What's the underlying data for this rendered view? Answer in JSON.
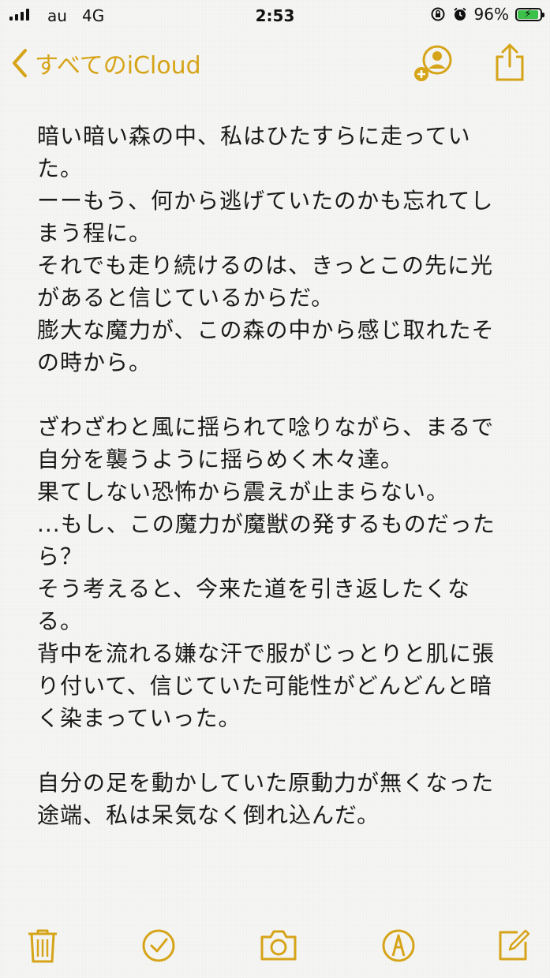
{
  "status_bar": {
    "carrier": "au",
    "network": "4G",
    "time": "2:53",
    "battery_text": "96%",
    "battery_level": 0.96
  },
  "nav": {
    "back_label": "すべてのiCloud",
    "back_icon": "chevron-left-icon",
    "add_person_icon": "add-person-icon",
    "share_icon": "share-icon"
  },
  "note": {
    "lines": [
      "暗い暗い森の中、私はひたすらに走ってい",
      "た。",
      "ーーもう、何から逃げていたのかも忘れてし",
      "まう程に。",
      "それでも走り続けるのは、きっとこの先に光",
      "があると信じているからだ。",
      "膨大な魔力が、この森の中から感じ取れたそ",
      "の時から。",
      "",
      "ざわざわと風に揺られて唸りながら、まるで",
      "自分を襲うように揺らめく木々達。",
      "果てしない恐怖から震えが止まらない。",
      "...もし、この魔力が魔獣の発するものだった",
      "ら？",
      "そう考えると、今来た道を引き返したくな",
      "る。",
      "背中を流れる嫌な汗で服がじっとりと肌に張",
      "り付いて、信じていた可能性がどんどんと暗",
      "く染まっていった。",
      "",
      "自分の足を動かしていた原動力が無くなった",
      "途端、私は呆気なく倒れ込んだ。"
    ]
  },
  "toolbar": {
    "items": [
      "trash-icon",
      "checklist-icon",
      "camera-icon",
      "markup-icon",
      "compose-icon"
    ]
  },
  "colors": {
    "accent": "#d6a419",
    "text": "#1a1a1a",
    "battery_green": "#3bc14a"
  }
}
